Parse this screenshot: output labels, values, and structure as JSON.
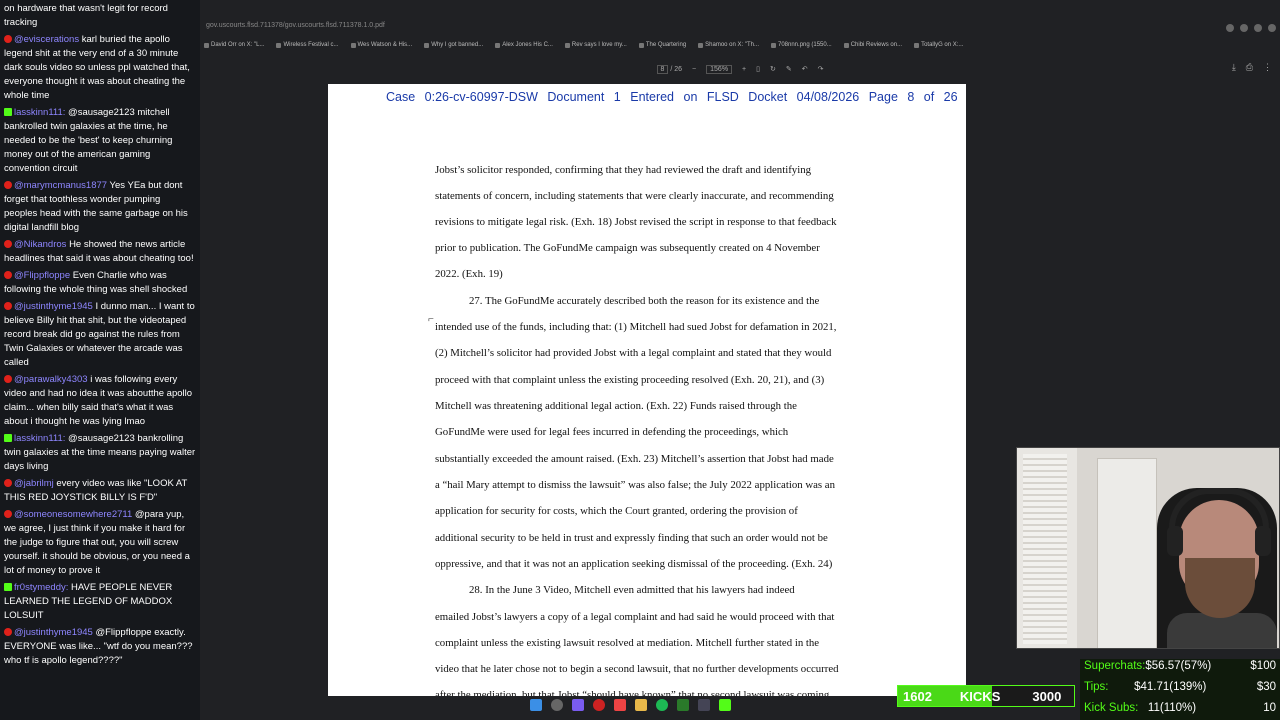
{
  "chat": {
    "messages": [
      {
        "platform": "yt",
        "user": "",
        "text": "on hardware that wasn't legit for record tracking"
      },
      {
        "platform": "yt",
        "user": "@eviscerations",
        "text": "karl buried the apollo legend shit at the very end of a 30 minute dark souls video so unless ppl watched that, everyone thought it was about cheating the whole time"
      },
      {
        "platform": "kick",
        "user": "lasskinn111:",
        "text": "@sausage2123 mitchell bankrolled twin galaxies at the time, he needed to be the 'best' to keep churning money out of the american gaming convention circuit"
      },
      {
        "platform": "yt",
        "user": "@marymcmanus1877",
        "text": "Yes YEa but dont forget that toothless wonder pumping peoples head with the same garbage on his digital landfill blog"
      },
      {
        "platform": "yt",
        "user": "@Nikandros",
        "text": "He showed the news article headlines that said it was about cheating too!"
      },
      {
        "platform": "yt",
        "user": "@Flippfloppe",
        "text": "Even Charlie who was following the whole thing was shell shocked"
      },
      {
        "platform": "yt",
        "user": "@justinthyme1945",
        "text": "I dunno man... I want to believe Billy hit that shit, but the videotaped record break did go against the rules from Twin Galaxies or whatever the arcade was called"
      },
      {
        "platform": "yt",
        "user": "@parawalky4303",
        "text": "i was following every video and had no idea it was aboutthe apollo claim... when billy said that's what it was about i thought he was lying lmao"
      },
      {
        "platform": "kick",
        "user": "lasskinn111:",
        "text": "@sausage2123 bankrolling twin galaxies at the time means paying walter days living"
      },
      {
        "platform": "yt",
        "user": "@jabrilmj",
        "text": "every video was like \"LOOK AT THIS RED JOYSTICK BILLY IS F'D\""
      },
      {
        "platform": "yt",
        "user": "@someonesomewhere2711",
        "text": "@para yup, we agree, I just think if you make it hard for the judge to figure that out, you will screw yourself. it should be obvious, or you need a lot of money to prove it"
      },
      {
        "platform": "kick",
        "user": "fr0stymeddy:",
        "text": "HAVE PEOPLE NEVER LEARNED THE LEGEND OF MADDOX LOLSUIT"
      },
      {
        "platform": "yt",
        "user": "@justinthyme1945",
        "text": "@Flippfloppe exactly. EVERYONE was like... \"wtf do you mean??? who tf is apollo legend????\""
      }
    ]
  },
  "browser": {
    "url": "gov.uscourts.flsd.711378/gov.uscourts.flsd.711378.1.0.pdf",
    "bookmarks": [
      "David Orr on X: \"L...",
      "Wireless Festival c...",
      "Wes Watson & His...",
      "Why I got banned...",
      "Alex Jones His C...",
      "Rev says I love my...",
      "The Quartering",
      "Shamoo on X: \"Th...",
      "708nnn.png (1550...",
      "Chibi Reviews on...",
      "TotallyG on X:..."
    ]
  },
  "pdf_toolbar": {
    "page_current": "8",
    "page_total": "/ 26",
    "zoom": "156%"
  },
  "document": {
    "header": "Case 0:26-cv-60997-DSW   Document 1   Entered on FLSD Docket 04/08/2026   Page 8 of 26",
    "lines": [
      "Jobst’s solicitor responded, confirming that they had reviewed the draft and identifying",
      "statements of concern, including statements that were clearly inaccurate, and recommending",
      "revisions to mitigate legal risk. (Exh. 18) Jobst revised the script in response to that feedback",
      "prior to publication. The GoFundMe campaign was subsequently created on 4 November",
      "2022. (Exh. 19)",
      "27.        The GoFundMe accurately described both the reason for its existence and the",
      "intended use of the funds, including that: (1) Mitchell had sued Jobst for defamation in 2021,",
      "(2) Mitchell’s solicitor had provided Jobst with a legal complaint and stated that they would",
      "proceed with that complaint unless the existing proceeding resolved (Exh. 20, 21), and (3)",
      "Mitchell was threatening additional legal action. (Exh. 22) Funds raised through the",
      "GoFundMe were used for legal fees incurred in defending the proceedings, which",
      "substantially exceeded the amount raised. (Exh. 23) Mitchell’s assertion that Jobst had made",
      "a “hail Mary attempt to dismiss the lawsuit” was also false; the July 2022 application was an",
      "application for security for costs, which the Court granted, ordering the provision of",
      "additional security to be held in trust and expressly finding that such an order would not be",
      "oppressive, and that it was not an application seeking dismissal of the proceeding. (Exh. 24)",
      "28.        In the June 3 Video, Mitchell even admitted that his lawyers had indeed",
      "emailed Jobst’s lawyers a copy of a legal complaint and had said he would proceed with that",
      "complaint unless the existing lawsuit resolved at mediation. Mitchell further stated in the",
      "video that he later chose not to begin a second lawsuit, that no further developments occurred",
      "after the mediation, but that Jobst “should have known” that no second lawsuit was coming"
    ]
  },
  "overlay": {
    "kicks_count": "1602",
    "kicks_label": "KICKS",
    "kicks_goal": "3000",
    "kicks_progress": 0.534,
    "superchats_label": "Superchats:",
    "superchats_value": "$56.57(57%)",
    "superchats_goal": "$100",
    "tips_label": "Tips:",
    "tips_value": "$41.71(139%)",
    "tips_goal": "$30",
    "kicksubs_label": "Kick Subs:",
    "kicksubs_value": "11(110%)",
    "kicksubs_goal": "10"
  }
}
